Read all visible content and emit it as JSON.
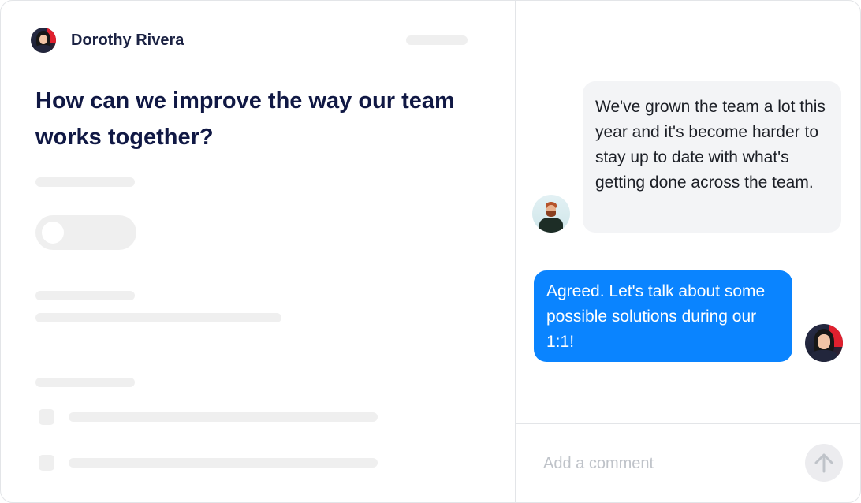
{
  "post": {
    "author_name": "Dorothy Rivera",
    "question": "How can we improve the way our team works together?"
  },
  "comments": [
    {
      "direction": "incoming",
      "text": "We've grown the team a lot this year and it's become harder to stay up to date with what's getting done across the team.",
      "avatar": "man-avatar"
    },
    {
      "direction": "outgoing",
      "text": "Agreed. Let's talk about some possible solutions during our 1:1!",
      "avatar": "dorothy-avatar"
    }
  ],
  "composer": {
    "placeholder": "Add a comment",
    "send_icon": "arrow-up-icon"
  },
  "colors": {
    "outgoing_bubble": "#0a84ff",
    "incoming_bubble": "#f3f4f6",
    "title_text": "#101844",
    "skeleton": "#efefef",
    "send_button_bg": "#ececef"
  }
}
